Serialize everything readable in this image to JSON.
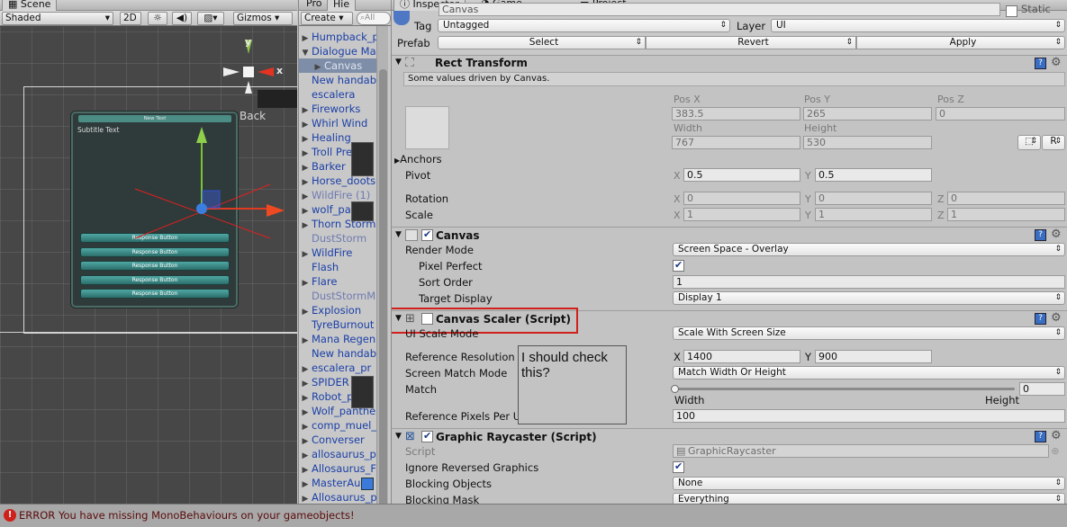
{
  "scene": {
    "tab": "Scene",
    "shading": "Shaded",
    "btn_2d": "2D",
    "gizmos": "Gizmos",
    "search_placeholder": "All",
    "back_label": "Back",
    "axis_y": "y",
    "axis_x": "x"
  },
  "game_preview": {
    "title": "New Text",
    "subtitle": "Subtitle Text",
    "buttons": [
      "Response Button",
      "Response Button",
      "Response Button",
      "Response Button",
      "Response Button"
    ]
  },
  "hierarchy": {
    "tabs": [
      "Pro",
      "Hie"
    ],
    "create": "Create",
    "search_placeholder": "All",
    "items": [
      {
        "label": "Humpback_p",
        "arrow": "▶",
        "grey": false
      },
      {
        "label": "Dialogue Ma",
        "arrow": "▼",
        "grey": false
      },
      {
        "label": "Canvas",
        "arrow": "▶",
        "grey": false,
        "selected": true
      },
      {
        "label": "New handab",
        "arrow": "",
        "grey": false
      },
      {
        "label": "escalera",
        "arrow": "",
        "grey": false
      },
      {
        "label": "Fireworks",
        "arrow": "▶",
        "grey": false
      },
      {
        "label": "Whirl Wind",
        "arrow": "▶",
        "grey": false
      },
      {
        "label": "Healing",
        "arrow": "▶",
        "grey": false
      },
      {
        "label": "Troll Pre",
        "arrow": "▶",
        "grey": false
      },
      {
        "label": "Barker",
        "arrow": "▶",
        "grey": false
      },
      {
        "label": "Horse_doots",
        "arrow": "▶",
        "grey": false
      },
      {
        "label": "WildFire (1)",
        "arrow": "▶",
        "grey": true
      },
      {
        "label": "wolf_pa",
        "arrow": "▶",
        "grey": false
      },
      {
        "label": "Thorn Storm",
        "arrow": "▶",
        "grey": false
      },
      {
        "label": "DustStorm",
        "arrow": "",
        "grey": true
      },
      {
        "label": "WildFire",
        "arrow": "▶",
        "grey": false
      },
      {
        "label": "Flash",
        "arrow": "",
        "grey": false
      },
      {
        "label": "Flare",
        "arrow": "▶",
        "grey": false
      },
      {
        "label": "DustStormM",
        "arrow": "",
        "grey": true
      },
      {
        "label": "Explosion",
        "arrow": "▶",
        "grey": false
      },
      {
        "label": "TyreBurnout",
        "arrow": "",
        "grey": false
      },
      {
        "label": "Mana Regen",
        "arrow": "▶",
        "grey": false
      },
      {
        "label": "New handab",
        "arrow": "",
        "grey": false
      },
      {
        "label": "escalera_pr",
        "arrow": "▶",
        "grey": false
      },
      {
        "label": "SPIDER",
        "arrow": "▶",
        "grey": false
      },
      {
        "label": "Robot_p",
        "arrow": "▶",
        "grey": false
      },
      {
        "label": "Wolf_panthe",
        "arrow": "▶",
        "grey": false
      },
      {
        "label": "comp_muel_",
        "arrow": "▶",
        "grey": false
      },
      {
        "label": "Converser",
        "arrow": "▶",
        "grey": false
      },
      {
        "label": "allosaurus_p",
        "arrow": "▶",
        "grey": false
      },
      {
        "label": "Allosaurus_F",
        "arrow": "▶",
        "grey": false
      },
      {
        "label": "MasterAu",
        "arrow": "▶",
        "grey": false
      },
      {
        "label": "Allosaurus_p",
        "arrow": "▶",
        "grey": false
      }
    ]
  },
  "inspector": {
    "tabs": {
      "inspector": "Inspector",
      "game": "Game",
      "project": "Project"
    },
    "name": "Canvas",
    "static": "Static",
    "tag_label": "Tag",
    "tag_value": "Untagged",
    "layer_label": "Layer",
    "layer_value": "UI",
    "prefab_label": "Prefab",
    "prefab_select": "Select",
    "prefab_revert": "Revert",
    "prefab_apply": "Apply",
    "rect": {
      "title": "Rect Transform",
      "note": "Some values driven by Canvas.",
      "posx_label": "Pos X",
      "posy_label": "Pos Y",
      "posz_label": "Pos Z",
      "posx": "383.5",
      "posy": "265",
      "posz": "0",
      "width_label": "Width",
      "height_label": "Height",
      "width": "767",
      "height": "530",
      "r_button": "R",
      "anchors": "Anchors",
      "pivot": "Pivot",
      "pivot_x": "0.5",
      "pivot_y": "0.5",
      "rotation": "Rotation",
      "rot_x": "0",
      "rot_y": "0",
      "rot_z": "0",
      "scale": "Scale",
      "scale_x": "1",
      "scale_y": "1",
      "scale_z": "1",
      "x": "X",
      "y": "Y",
      "z": "Z"
    },
    "canvas": {
      "title": "Canvas",
      "render_mode_label": "Render Mode",
      "render_mode": "Screen Space - Overlay",
      "pixel_perfect": "Pixel Perfect",
      "sort_order_label": "Sort Order",
      "sort_order": "1",
      "target_display_label": "Target Display",
      "target_display": "Display 1"
    },
    "scaler": {
      "title": "Canvas Scaler (Script)",
      "ui_scale_mode_label": "UI Scale Mode",
      "ui_scale_mode": "Scale With Screen Size",
      "ref_res_label": "Reference Resolution",
      "ref_x": "1400",
      "ref_y": "900",
      "match_mode_label": "Screen Match Mode",
      "match_mode": "Match Width Or Height",
      "match_label": "Match",
      "match_value": "0",
      "match_level": 0,
      "width_label": "Width",
      "height_label": "Height",
      "ref_ppu_label": "Reference Pixels Per Unit",
      "ref_ppu": "100"
    },
    "note": "I should check this?",
    "raycaster": {
      "title": "Graphic Raycaster (Script)",
      "script_label": "Script",
      "script_value": "GraphicRaycaster",
      "ignore_label": "Ignore Reversed Graphics",
      "blocking_objects_label": "Blocking Objects",
      "blocking_objects": "None",
      "blocking_mask_label": "Blocking Mask",
      "blocking_mask": "Everything"
    }
  },
  "status": {
    "message": "ERROR You have missing MonoBehaviours on your gameobjects!"
  },
  "colors": {
    "highlight": "#d0201a",
    "selection": "#7f8ea8",
    "link": "#1a3fa8"
  }
}
